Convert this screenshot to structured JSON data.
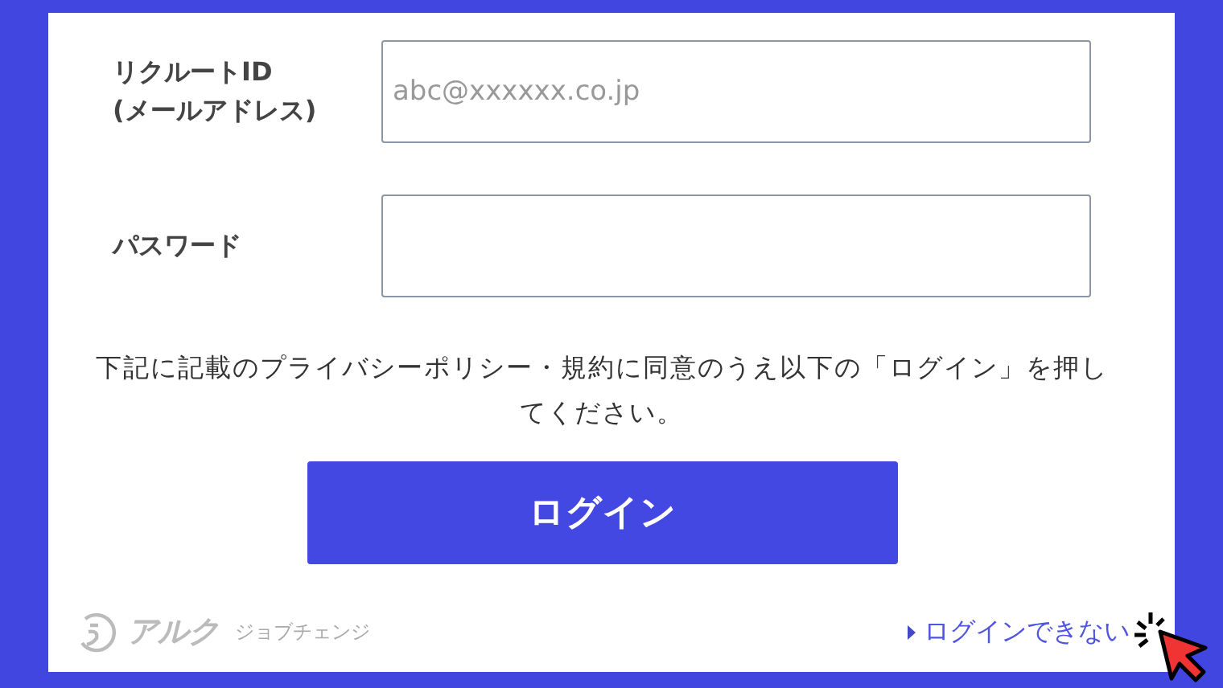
{
  "fields": [
    {
      "label": "リクルートID\n(メールアドレス)",
      "placeholder": "abc@xxxxxx.co.jp"
    },
    {
      "label": "パスワード"
    }
  ],
  "notice": "下記に記載のプライバシーポリシー・規約に同意のうえ以下の「ログイン」を押してください。",
  "login_button": "ログイン",
  "logo": {
    "brand": "アルク",
    "service": "ジョブチェンジ"
  },
  "help_link": "ログインできない"
}
